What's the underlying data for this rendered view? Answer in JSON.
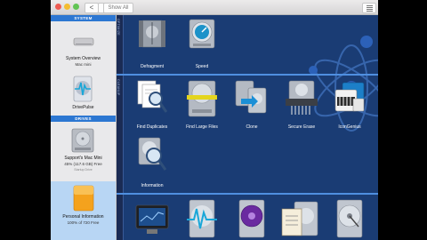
{
  "toolbar": {
    "back_label": "<",
    "forward_label": ">",
    "show_all_label": "Show All"
  },
  "sidebar": {
    "system_header": "SYSTEM",
    "system_overview_name": "System Overview",
    "system_overview_sub": "Mac mini",
    "drivepulse_name": "DrivePulse",
    "drives_header": "DRIVES",
    "drive_name": "Support's Mac Mini",
    "drive_free": "45% (117.6 GB) Free",
    "drive_status": "Startup Drive",
    "personal_name": "Personal Information",
    "personal_free": "100% of 720 Free"
  },
  "sections": {
    "optimize_label": "OPTIMIZE",
    "cleanup_label": "CLEANUP"
  },
  "tiles": {
    "defragment": "Defragment",
    "speed": "Speed",
    "find_duplicates": "Find Duplicates",
    "find_large_files": "Find Large Files",
    "clone": "Clone",
    "secure_erase": "Secure Erase",
    "icon_genius": "IconGenius",
    "information": "Information"
  },
  "colors": {
    "background": "#1a3c74",
    "accent": "#2c77d2",
    "sidebar": "#e9e9eb"
  }
}
